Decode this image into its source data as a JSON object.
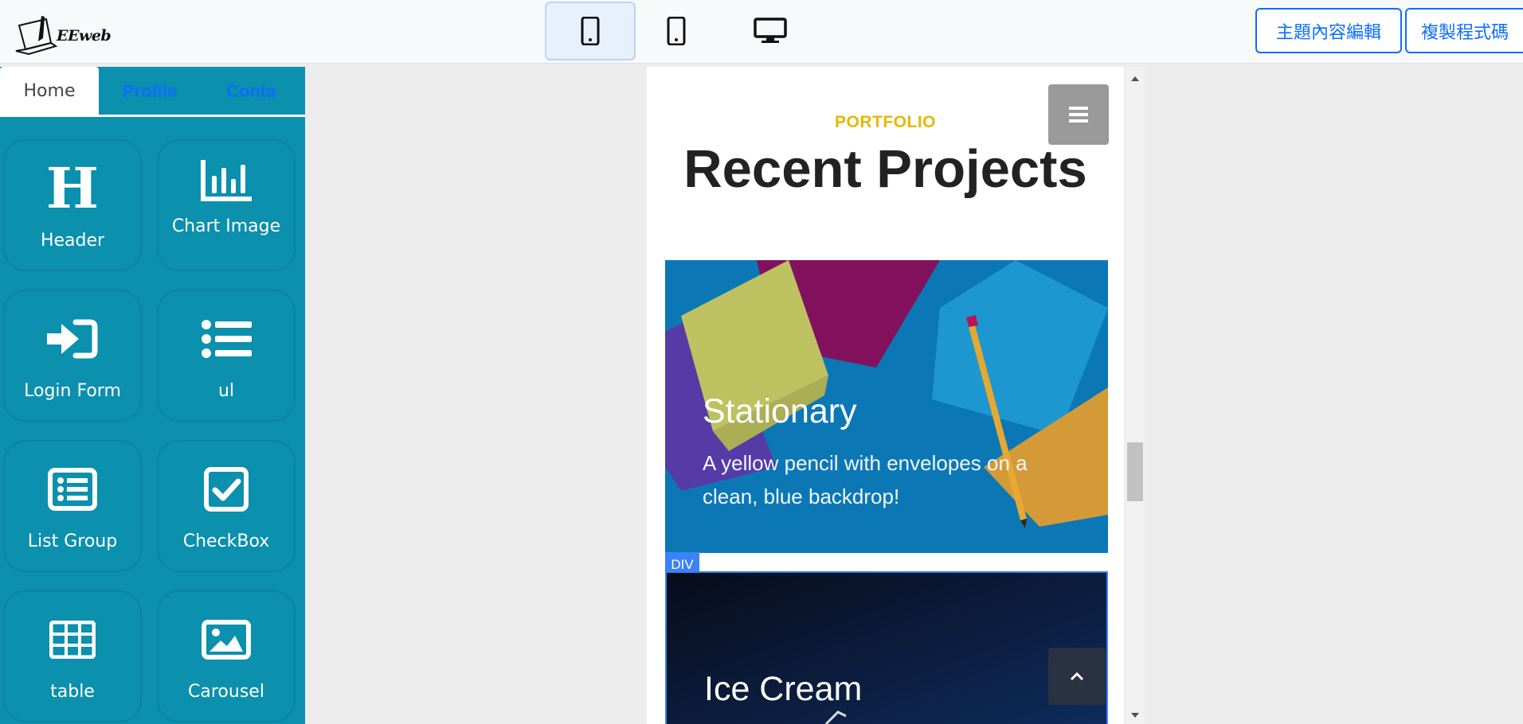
{
  "app": {
    "logo_text": "EEweb"
  },
  "toolbar": {
    "devices": [
      "mobile",
      "tablet",
      "desktop"
    ],
    "active_device": "mobile",
    "edit_theme_label": "主題內容編輯",
    "copy_code_label": "複製程式碼"
  },
  "sidebar": {
    "tabs": [
      {
        "label": "Home",
        "active": true
      },
      {
        "label": "Profile",
        "active": false
      },
      {
        "label": "Conta",
        "active": false
      }
    ],
    "components": [
      {
        "label": "Header",
        "icon": "heading-icon"
      },
      {
        "label": "Chart Image",
        "icon": "bar-chart-icon"
      },
      {
        "label": "Login Form",
        "icon": "sign-in-icon"
      },
      {
        "label": "ul",
        "icon": "list-icon"
      },
      {
        "label": "List Group",
        "icon": "list-group-icon"
      },
      {
        "label": "CheckBox",
        "icon": "checkbox-icon"
      },
      {
        "label": "table",
        "icon": "table-icon"
      },
      {
        "label": "Carousel",
        "icon": "image-icon"
      }
    ]
  },
  "preview": {
    "kicker": "PORTFOLIO",
    "title": "Recent Projects",
    "cards": [
      {
        "title": "Stationary",
        "text": "A yellow pencil with envelopes on a clean, blue backdrop!"
      },
      {
        "title": "Ice Cream",
        "text": ""
      }
    ],
    "selected_tag": "DIV"
  },
  "colors": {
    "sidebar_bg": "#0b90ad",
    "accent": "#0d6efd",
    "kicker": "#e6b800",
    "selection": "#3b82f6"
  }
}
